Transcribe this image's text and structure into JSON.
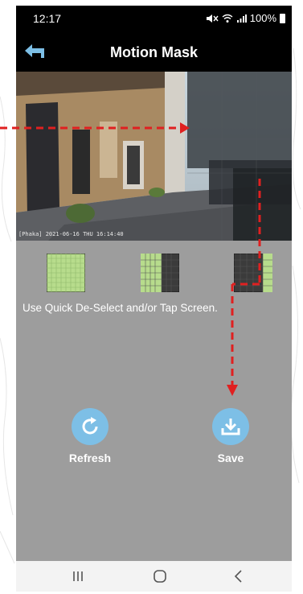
{
  "status_bar": {
    "time": "12:17",
    "battery": "100%"
  },
  "header": {
    "title": "Motion Mask"
  },
  "camera": {
    "timestamp": "[Phaka] 2021-06-16 THU 16:14:40"
  },
  "presets": [
    {
      "name": "full-area",
      "icon": "full-grid-icon"
    },
    {
      "name": "left-half",
      "icon": "half-grid-icon"
    },
    {
      "name": "right-strip",
      "icon": "strip-grid-icon"
    }
  ],
  "instructions": "Use Quick De-Select and/or Tap Screen.",
  "actions": {
    "refresh_label": "Refresh",
    "save_label": "Save"
  },
  "colors": {
    "accent": "#7dbfe6",
    "mask_active": "#b7dc8c",
    "mask_inactive": "#3b3b3b",
    "annotation": "#e02020"
  }
}
